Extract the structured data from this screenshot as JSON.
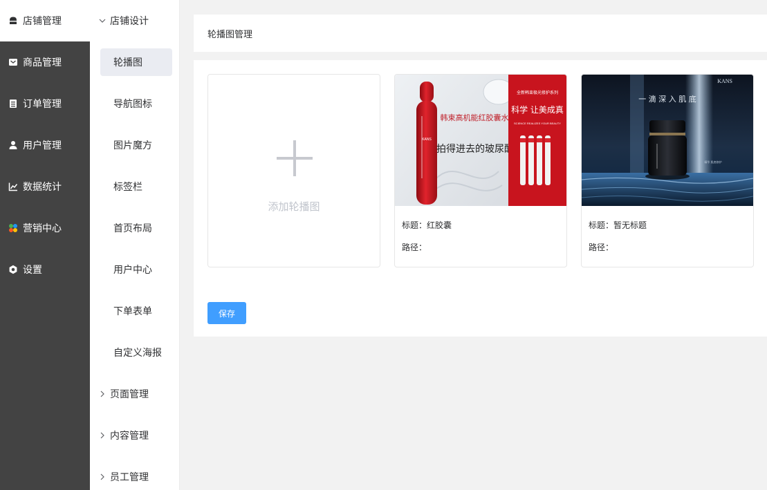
{
  "main_nav": [
    {
      "label": "店铺管理",
      "icon": "store-icon",
      "active": true
    },
    {
      "label": "商品管理",
      "icon": "goods-icon"
    },
    {
      "label": "订单管理",
      "icon": "order-icon"
    },
    {
      "label": "用户管理",
      "icon": "user-icon"
    },
    {
      "label": "数据统计",
      "icon": "chart-icon"
    },
    {
      "label": "营销中心",
      "icon": "marketing-icon"
    },
    {
      "label": "设置",
      "icon": "settings-icon"
    }
  ],
  "sub_nav": {
    "group_open": {
      "label": "店铺设计",
      "icon": "chevron-down-icon"
    },
    "items": [
      "轮播图",
      "导航图标",
      "图片魔方",
      "标签栏",
      "首页布局",
      "用户中心",
      "下单表单",
      "自定义海报"
    ],
    "active_item": "轮播图",
    "groups_closed": [
      {
        "label": "页面管理",
        "icon": "chevron-right-icon"
      },
      {
        "label": "内容管理",
        "icon": "chevron-right-icon"
      },
      {
        "label": "员工管理",
        "icon": "chevron-right-icon"
      }
    ]
  },
  "page": {
    "title": "轮播图管理"
  },
  "add_card": {
    "label": "添加轮播图",
    "icon": "plus-icon"
  },
  "banners": [
    {
      "title_label": "标题：",
      "title_value": "红胶囊",
      "path_label": "路径：",
      "path_value": "",
      "image": {
        "headline_top": "韩束高机能红胶囊水",
        "headline_bottom": "拍得进去的玻尿酸",
        "panel_small": "全新韩束极光修护系列",
        "panel_main": "科学 让美成真",
        "panel_tagline": "SCIENCE REALIZES YOUR BEAUTY",
        "bottle_text": "KANS"
      }
    },
    {
      "title_label": "标题：",
      "title_value": "暂无标题",
      "path_label": "路径：",
      "path_value": "",
      "image": {
        "brand": "KANS",
        "slogan": "一 滴 深 入 肌 底",
        "small_text": "精华 肌底修护"
      }
    }
  ],
  "save_label": "保存",
  "colors": {
    "sidebar": "#434343",
    "primary": "#409eff",
    "banner_red": "#c8141e"
  }
}
